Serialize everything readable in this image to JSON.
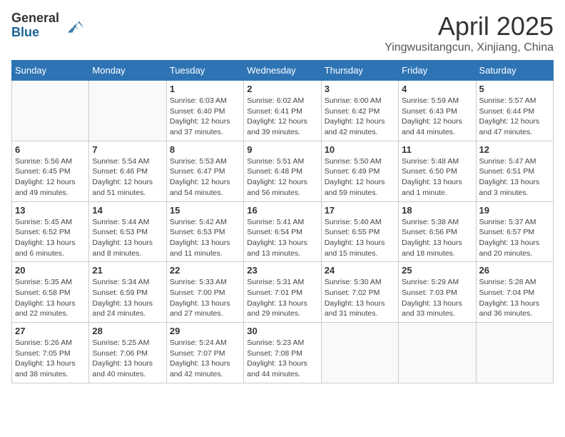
{
  "header": {
    "logo_line1": "General",
    "logo_line2": "Blue",
    "month_year": "April 2025",
    "location": "Yingwusitangcun, Xinjiang, China"
  },
  "days_of_week": [
    "Sunday",
    "Monday",
    "Tuesday",
    "Wednesday",
    "Thursday",
    "Friday",
    "Saturday"
  ],
  "weeks": [
    [
      {
        "day": "",
        "info": ""
      },
      {
        "day": "",
        "info": ""
      },
      {
        "day": "1",
        "info": "Sunrise: 6:03 AM\nSunset: 6:40 PM\nDaylight: 12 hours and 37 minutes."
      },
      {
        "day": "2",
        "info": "Sunrise: 6:02 AM\nSunset: 6:41 PM\nDaylight: 12 hours and 39 minutes."
      },
      {
        "day": "3",
        "info": "Sunrise: 6:00 AM\nSunset: 6:42 PM\nDaylight: 12 hours and 42 minutes."
      },
      {
        "day": "4",
        "info": "Sunrise: 5:59 AM\nSunset: 6:43 PM\nDaylight: 12 hours and 44 minutes."
      },
      {
        "day": "5",
        "info": "Sunrise: 5:57 AM\nSunset: 6:44 PM\nDaylight: 12 hours and 47 minutes."
      }
    ],
    [
      {
        "day": "6",
        "info": "Sunrise: 5:56 AM\nSunset: 6:45 PM\nDaylight: 12 hours and 49 minutes."
      },
      {
        "day": "7",
        "info": "Sunrise: 5:54 AM\nSunset: 6:46 PM\nDaylight: 12 hours and 51 minutes."
      },
      {
        "day": "8",
        "info": "Sunrise: 5:53 AM\nSunset: 6:47 PM\nDaylight: 12 hours and 54 minutes."
      },
      {
        "day": "9",
        "info": "Sunrise: 5:51 AM\nSunset: 6:48 PM\nDaylight: 12 hours and 56 minutes."
      },
      {
        "day": "10",
        "info": "Sunrise: 5:50 AM\nSunset: 6:49 PM\nDaylight: 12 hours and 59 minutes."
      },
      {
        "day": "11",
        "info": "Sunrise: 5:48 AM\nSunset: 6:50 PM\nDaylight: 13 hours and 1 minute."
      },
      {
        "day": "12",
        "info": "Sunrise: 5:47 AM\nSunset: 6:51 PM\nDaylight: 13 hours and 3 minutes."
      }
    ],
    [
      {
        "day": "13",
        "info": "Sunrise: 5:45 AM\nSunset: 6:52 PM\nDaylight: 13 hours and 6 minutes."
      },
      {
        "day": "14",
        "info": "Sunrise: 5:44 AM\nSunset: 6:53 PM\nDaylight: 13 hours and 8 minutes."
      },
      {
        "day": "15",
        "info": "Sunrise: 5:42 AM\nSunset: 6:53 PM\nDaylight: 13 hours and 11 minutes."
      },
      {
        "day": "16",
        "info": "Sunrise: 5:41 AM\nSunset: 6:54 PM\nDaylight: 13 hours and 13 minutes."
      },
      {
        "day": "17",
        "info": "Sunrise: 5:40 AM\nSunset: 6:55 PM\nDaylight: 13 hours and 15 minutes."
      },
      {
        "day": "18",
        "info": "Sunrise: 5:38 AM\nSunset: 6:56 PM\nDaylight: 13 hours and 18 minutes."
      },
      {
        "day": "19",
        "info": "Sunrise: 5:37 AM\nSunset: 6:57 PM\nDaylight: 13 hours and 20 minutes."
      }
    ],
    [
      {
        "day": "20",
        "info": "Sunrise: 5:35 AM\nSunset: 6:58 PM\nDaylight: 13 hours and 22 minutes."
      },
      {
        "day": "21",
        "info": "Sunrise: 5:34 AM\nSunset: 6:59 PM\nDaylight: 13 hours and 24 minutes."
      },
      {
        "day": "22",
        "info": "Sunrise: 5:33 AM\nSunset: 7:00 PM\nDaylight: 13 hours and 27 minutes."
      },
      {
        "day": "23",
        "info": "Sunrise: 5:31 AM\nSunset: 7:01 PM\nDaylight: 13 hours and 29 minutes."
      },
      {
        "day": "24",
        "info": "Sunrise: 5:30 AM\nSunset: 7:02 PM\nDaylight: 13 hours and 31 minutes."
      },
      {
        "day": "25",
        "info": "Sunrise: 5:29 AM\nSunset: 7:03 PM\nDaylight: 13 hours and 33 minutes."
      },
      {
        "day": "26",
        "info": "Sunrise: 5:28 AM\nSunset: 7:04 PM\nDaylight: 13 hours and 36 minutes."
      }
    ],
    [
      {
        "day": "27",
        "info": "Sunrise: 5:26 AM\nSunset: 7:05 PM\nDaylight: 13 hours and 38 minutes."
      },
      {
        "day": "28",
        "info": "Sunrise: 5:25 AM\nSunset: 7:06 PM\nDaylight: 13 hours and 40 minutes."
      },
      {
        "day": "29",
        "info": "Sunrise: 5:24 AM\nSunset: 7:07 PM\nDaylight: 13 hours and 42 minutes."
      },
      {
        "day": "30",
        "info": "Sunrise: 5:23 AM\nSunset: 7:08 PM\nDaylight: 13 hours and 44 minutes."
      },
      {
        "day": "",
        "info": ""
      },
      {
        "day": "",
        "info": ""
      },
      {
        "day": "",
        "info": ""
      }
    ]
  ]
}
